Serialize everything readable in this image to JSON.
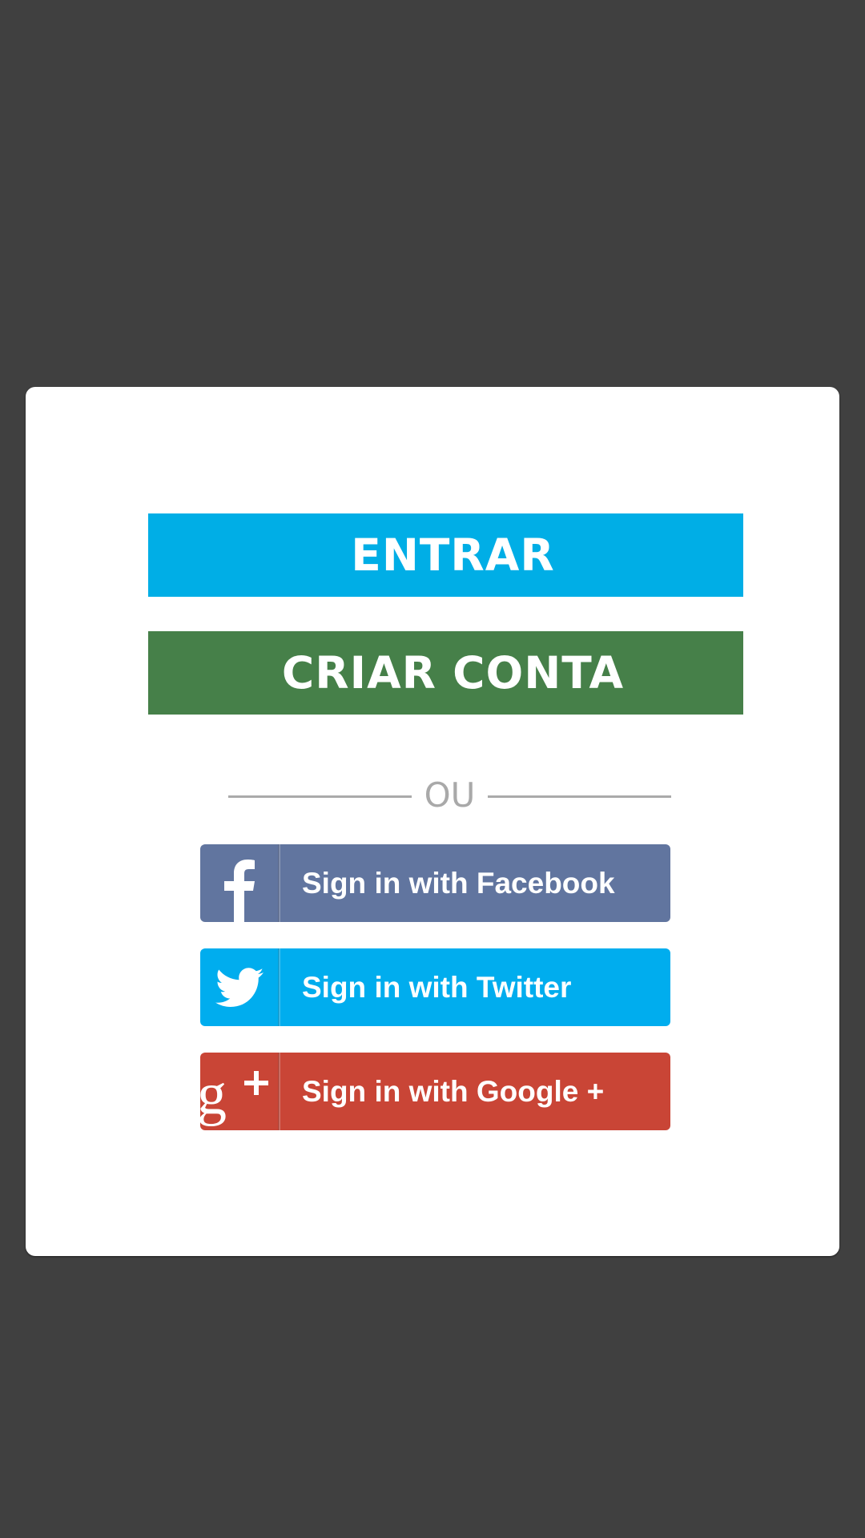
{
  "colors": {
    "background": "#404040",
    "card": "#ffffff",
    "entrar": "#00aee6",
    "criar_conta": "#468049",
    "divider": "#aaaaaa",
    "facebook": "#61759f",
    "twitter": "#00adee",
    "google": "#c94536"
  },
  "auth": {
    "entrar_label": "ENTRAR",
    "criar_conta_label": "CRIAR CONTA",
    "divider_text": "OU"
  },
  "social": {
    "facebook": {
      "label": "Sign in with Facebook",
      "icon": "facebook-icon"
    },
    "twitter": {
      "label": "Sign in with Twitter",
      "icon": "twitter-bird-icon"
    },
    "google": {
      "label": "Sign in with Google +",
      "icon": "google-plus-icon"
    }
  }
}
